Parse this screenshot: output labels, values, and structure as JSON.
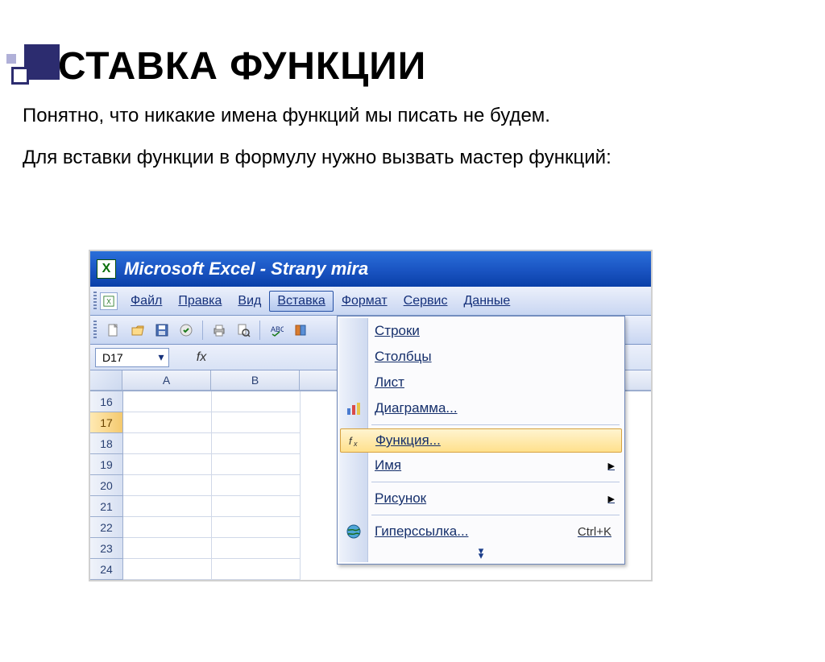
{
  "slide": {
    "title": "ВСТАВКА ФУНКЦИИ",
    "p1": "Понятно, что никакие имена функций мы писать не будем.",
    "p2": "Для вставки функции в формулу нужно вызвать мастер функций:"
  },
  "excel": {
    "title": "Microsoft Excel - Strany mira",
    "menu": {
      "file": "Файл",
      "edit": "Правка",
      "view": "Вид",
      "insert": "Вставка",
      "format": "Формат",
      "tools": "Сервис",
      "data": "Данные"
    },
    "namebox": "D17",
    "fx_label": "fx",
    "columns": [
      "A",
      "B"
    ],
    "rows": [
      "16",
      "17",
      "18",
      "19",
      "20",
      "21",
      "22",
      "23",
      "24"
    ],
    "selected_row": "17",
    "insert_menu": {
      "rows": "Строки",
      "columns": "Столбцы",
      "sheet": "Лист",
      "chart": "Диаграмма...",
      "function": "Функция...",
      "name": "Имя",
      "picture": "Рисунок",
      "hyperlink": "Гиперссылка...",
      "hyperlink_shortcut": "Ctrl+K"
    }
  }
}
